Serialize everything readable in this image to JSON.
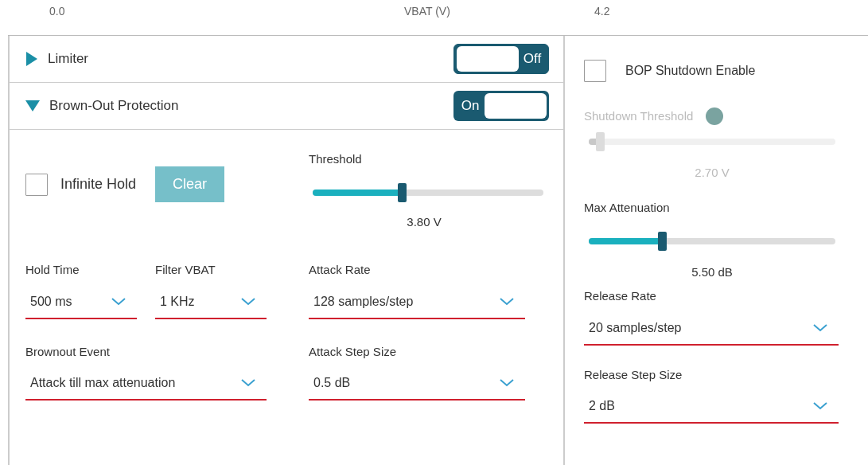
{
  "axis": {
    "min": "0.0",
    "label": "VBAT (V)",
    "max": "4.2"
  },
  "sections": [
    {
      "title": "Limiter",
      "expanded": false,
      "on": false,
      "state_label": "Off"
    },
    {
      "title": "Brown-Out Protection",
      "expanded": true,
      "on": true,
      "state_label": "On"
    }
  ],
  "brown_out": {
    "infinite_hold": {
      "label": "Infinite Hold",
      "checked": false
    },
    "clear_button": {
      "label": "Clear",
      "disabled": true
    },
    "threshold": {
      "label": "Threshold",
      "level": 0.37,
      "reading": "3.80 V"
    },
    "dropdowns": [
      {
        "label": "Hold Time",
        "value": "500 ms"
      },
      {
        "label": "Filter VBAT",
        "value": "1 KHz"
      },
      {
        "label": "Attack Rate",
        "value": "128 samples/step"
      },
      {
        "label": "Brownout Event",
        "value": "Attack till max attenuation"
      },
      {
        "label": "Attack Step Size",
        "value": "0.5 dB"
      }
    ]
  },
  "shutdown": {
    "bop_shutdown": {
      "label": "BOP Shutdown Enable",
      "checked": false
    },
    "shutdown_threshold": {
      "label": "Shutdown Threshold",
      "disabled": true,
      "level": 0.03,
      "reading": "2.70 V"
    },
    "max_attenuation": {
      "label": "Max Attenuation",
      "level": 0.28,
      "reading": "5.50 dB"
    },
    "dropdowns": [
      {
        "label": "Release Rate",
        "value": "20 samples/step"
      },
      {
        "label": "Release Step Size",
        "value": "2 dB"
      }
    ]
  }
}
